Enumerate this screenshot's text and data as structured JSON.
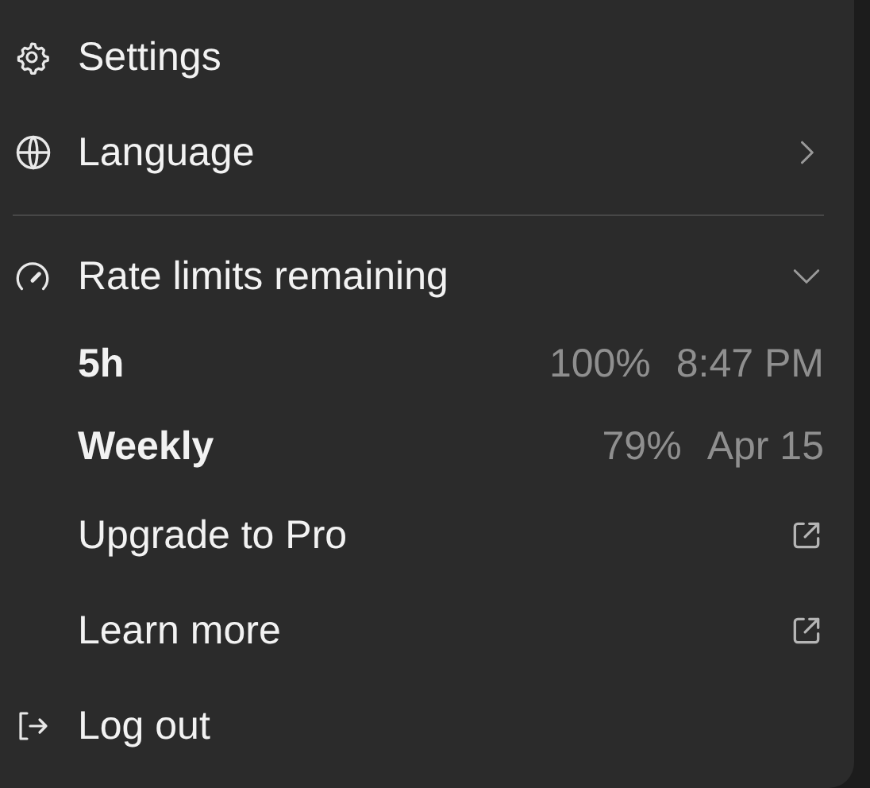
{
  "menu": {
    "items": [
      {
        "kind": "settings",
        "label": "Settings"
      },
      {
        "kind": "language",
        "label": "Language"
      },
      {
        "kind": "section",
        "label": "Rate limits remaining",
        "expanded": true
      },
      {
        "kind": "limit",
        "label": "5h",
        "percent": "100%",
        "reset": "8:47 PM"
      },
      {
        "kind": "limit",
        "label": "Weekly",
        "percent": "79%",
        "reset": "Apr 15"
      },
      {
        "kind": "link",
        "label": "Upgrade to Pro"
      },
      {
        "kind": "link",
        "label": "Learn more"
      },
      {
        "kind": "logout",
        "label": "Log out"
      }
    ]
  }
}
